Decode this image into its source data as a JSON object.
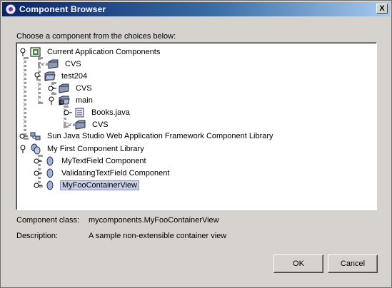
{
  "window": {
    "title": "Component Browser",
    "close_label": "X"
  },
  "prompt": "Choose a component from the choices below:",
  "tree": {
    "nodes": [
      {
        "label": "Current Application Components"
      },
      {
        "label": "CVS"
      },
      {
        "label": "test204"
      },
      {
        "label": "CVS"
      },
      {
        "label": "main"
      },
      {
        "label": "Books.java"
      },
      {
        "label": "CVS"
      },
      {
        "label": "Sun Java Studio Web Application Framework Component Library"
      },
      {
        "label": "My First Component Library"
      },
      {
        "label": "MyTextField Component"
      },
      {
        "label": "ValidatingTextField Component"
      },
      {
        "label": "MyFooContainerView"
      }
    ]
  },
  "details": {
    "class_label": "Component class:",
    "class_value": "mycomponents.MyFooContainerView",
    "description_label": "Description:",
    "description_value": "A sample non-extensible container view"
  },
  "buttons": {
    "ok": "OK",
    "cancel": "Cancel"
  }
}
